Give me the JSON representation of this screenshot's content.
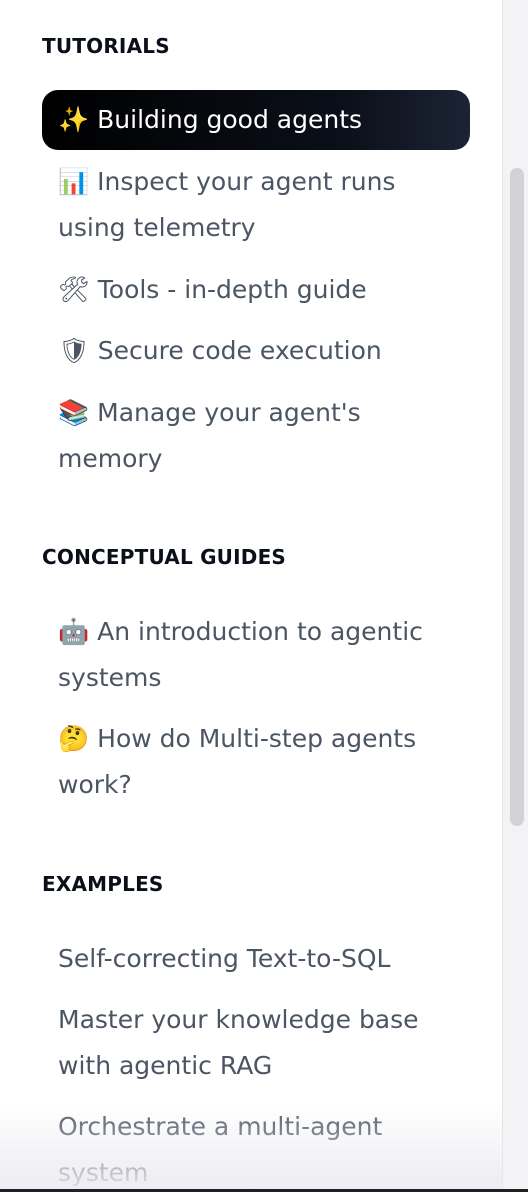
{
  "sections": [
    {
      "title": "TUTORIALS",
      "items": [
        {
          "emoji": "✨",
          "label": "Building good agents"
        },
        {
          "emoji": "📊",
          "label": "Inspect your agent runs using telemetry"
        },
        {
          "emoji": "🛠",
          "label": "Tools - in-depth guide"
        },
        {
          "emoji": "🛡",
          "label": "Secure code execution"
        },
        {
          "emoji": "📚",
          "label": "Manage your agent's memory"
        }
      ]
    },
    {
      "title": "CONCEPTUAL GUIDES",
      "items": [
        {
          "emoji": "🤖",
          "label": "An introduction to agentic systems"
        },
        {
          "emoji": "🤔",
          "label": "How do Multi-step agents work?"
        }
      ]
    },
    {
      "title": "EXAMPLES",
      "items": [
        {
          "label": "Self-correcting Text-to-SQL"
        },
        {
          "label": "Master your knowledge base with agentic RAG"
        },
        {
          "label": "Orchestrate a multi-agent system"
        }
      ]
    }
  ],
  "active_item": "Building good agents",
  "colors": {
    "active_bg": "#0b0f19",
    "active_text": "#ffffff",
    "item_text": "#4b5563",
    "heading_text": "#0b0f19"
  }
}
